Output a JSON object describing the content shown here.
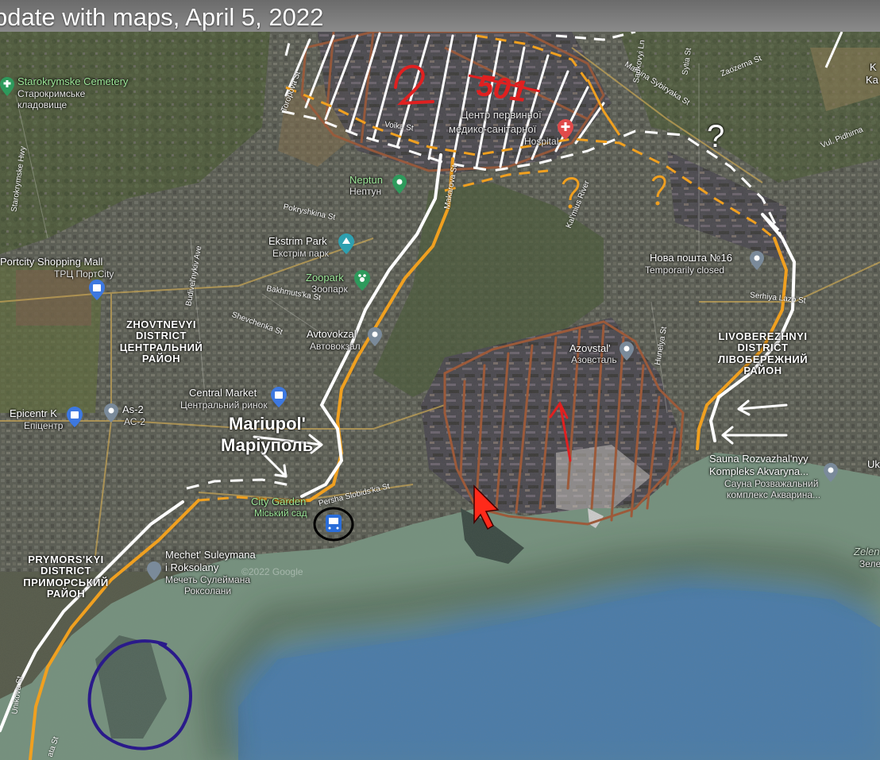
{
  "title": "pdate with maps, April 5, 2022",
  "places": {
    "cemetery": {
      "name": "Starokrymske Cemetery",
      "local": "Старокримське",
      "local2": "кладовище"
    },
    "neptun": {
      "name": "Neptun",
      "local": "Нептун"
    },
    "ekstrim": {
      "name": "Ekstrim Park",
      "local": "Екстрім парк"
    },
    "zoopark": {
      "name": "Zoopark",
      "local": "Зоопарк"
    },
    "portcity": {
      "name": "Portcity Shopping Mall",
      "local": "ТРЦ ПортCity"
    },
    "avtovokzal": {
      "name": "Avtovokzal",
      "local": "Автовокзал"
    },
    "central_market": {
      "name": "Central Market",
      "local": "Центральний ринок"
    },
    "epicentr": {
      "name": "Epicentr K",
      "local": "Епіцентр"
    },
    "as2": {
      "name": "As-2",
      "local": "АС-2"
    },
    "city_garden": {
      "name": "City Garden",
      "local": "Міський сад"
    },
    "mechet": {
      "name": "Mechet' Suleymana",
      "name2": "i Roksolany",
      "local": "Мечеть Сулеймана",
      "local2": "Роксолани"
    },
    "centr": {
      "name": "Центр первинної",
      "name2": "медико-санітарної",
      "name3": "Hospital"
    },
    "azovstal": {
      "name": "Azovstal'",
      "local": "Азовсталь"
    },
    "nova_poshta": {
      "name": "Нова пошта №16",
      "status": "Temporarily closed"
    },
    "sauna": {
      "name": "Sauna Rozvazhal'nyy",
      "name2": "Kompleks Akvaryna...",
      "local": "Сауна Розважальний",
      "local2": "комплекс Акварина..."
    },
    "zelen": {
      "name": "Zelen",
      "local": "Зеле"
    },
    "edge_k": {
      "name": "K",
      "name2": "Ka"
    },
    "edge_uk": {
      "name": "Uk"
    }
  },
  "districts": {
    "zhovtnevyi": {
      "l1": "ZHOVTNEVYI",
      "l2": "DISTRICT",
      "l3": "ЦЕНТРАЛЬНИЙ",
      "l4": "РАЙОН"
    },
    "livoberezhnyi": {
      "l1": "LIVOBEREZHNYI",
      "l2": "DISTRICT",
      "l3": "ЛІВОБЕРЕЖНИЙ",
      "l4": "РАЙОН"
    },
    "prymorskyi": {
      "l1": "PRYMORS'KYI",
      "l2": "DISTRICT",
      "l3": "ПРИМОРСЬКИЙ",
      "l4": "РАЙОН"
    }
  },
  "city": {
    "name": "Mariupol'",
    "local": "Маріуполь"
  },
  "streets": {
    "starokrymske_hwy": "Starokrymske Hwy",
    "toropova": "Toropova St",
    "voika": "Voika St",
    "makarova": "Makarova St",
    "pokryshkina": "Pokryshkina St",
    "budivelnykiv": "Budivel'nykiv Ave",
    "bakhmutska": "Bakhmuts'ka St",
    "shevchenka": "Shevchenka St",
    "persha_slobidska": "Persha Slobids'ka St",
    "kalmius_river": "Kal'mius River",
    "marina_sybiryaka": "Mamina Sybiryaka St",
    "serhiya_lazo": "Serhiya Lazo St",
    "hunelya": "Hunelya St",
    "zaozerna": "Zaozerna St",
    "sadkovyi": "Sadkovyi Ln",
    "sytia": "Sytia St",
    "pidhirna": "Vul. Pidhirna",
    "unikova": "Unikova St",
    "ata": "ata St"
  },
  "annotations": {
    "num_2": "2",
    "num_501": "501",
    "q1": "?",
    "q2": "?",
    "q3": "?"
  },
  "watermark": "©2022 Google",
  "colors": {
    "orange_line": "#f0a020",
    "white_line": "#ffffff",
    "red": "#e02020",
    "brown": "#9c5a3a",
    "purple": "#2a1a8a",
    "black": "#000000",
    "sea_near": "#7d9a86",
    "sea_far": "#4d7ca8"
  },
  "icons": {
    "cemetery": "cemetery-pin-icon",
    "neptun": "shopping-pin-icon",
    "ekstrim": "park-pin-icon",
    "zoopark": "zoo-pin-icon",
    "portcity": "shopping-bag-pin-icon",
    "avtovokzal": "location-pin-icon",
    "central_market": "shopping-bag-pin-icon",
    "epicentr": "shopping-bag-pin-icon",
    "as2": "location-pin-icon",
    "hospital": "hospital-pin-icon",
    "azovstal": "location-pin-icon",
    "nova_poshta": "location-pin-icon",
    "sauna": "location-pin-icon",
    "mechet": "mosque-pin-icon",
    "transit": "bus-station-icon"
  }
}
